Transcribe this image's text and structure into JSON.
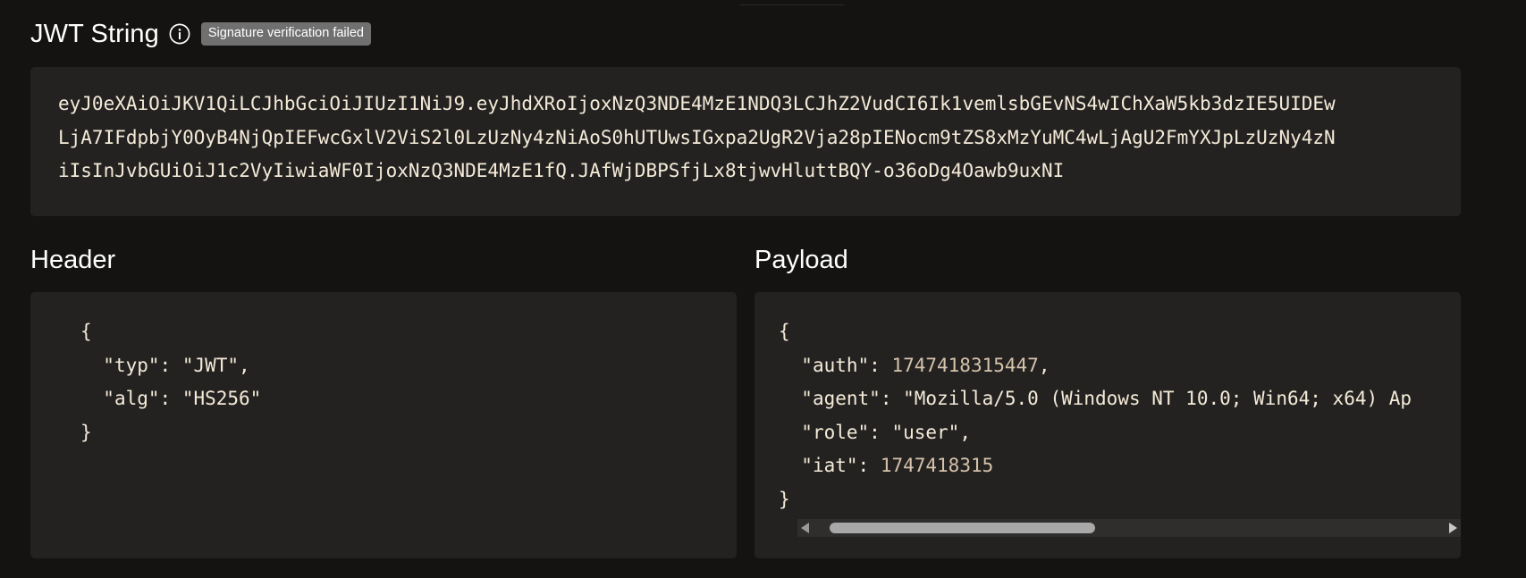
{
  "jwt": {
    "title": "JWT String",
    "info_icon": "info-circle-icon",
    "status_badge": "Signature verification failed",
    "status_badge_color": "#707070",
    "token_lines": [
      "eyJ0eXAiOiJKV1QiLCJhbGciOiJIUzI1NiJ9.eyJhdXRoIjoxNzQ3NDE4MzE1NDQ3LCJhZ2VudCI6Ik1vemlsbGEvNS4wIChXaW5kb3dzIE5UIDEw",
      "LjA7IFdpbjY0OyB4NjQpIEFwcGxlV2ViS2l0LzUzNy4zNiAoS0hUTUwsIGxpa2UgR2Vja28pIENocm9tZS8xMzYuMC4wLjAgU2FmYXJpLzUzNy4zN",
      "iIsInJvbGUiOiJ1c2VyIiwiaWF0IjoxNzQ3NDE4MzE1fQ.JAfWjDBPSfjLx8tjwvHluttBQY-o36oDg4Oawb9uxNI"
    ]
  },
  "header": {
    "title": "Header",
    "open_brace": "{",
    "close_brace": "}",
    "typ_key": "\"typ\"",
    "typ_value": "\"JWT\"",
    "alg_key": "\"alg\"",
    "alg_value": "\"HS256\""
  },
  "payload": {
    "title": "Payload",
    "open_brace": "{",
    "close_brace": "}",
    "auth_key": "\"auth\"",
    "auth_value": "1747418315447",
    "agent_key": "\"agent\"",
    "agent_value": "\"Mozilla/5.0 (Windows NT 10.0; Win64; x64) Ap",
    "role_key": "\"role\"",
    "role_value": "\"user\"",
    "iat_key": "\"iat\"",
    "iat_value": "1747418315"
  },
  "colors": {
    "background": "#141312",
    "panel": "#232221",
    "code_text": "#f4ead8",
    "number_text": "#d6c3ab"
  }
}
